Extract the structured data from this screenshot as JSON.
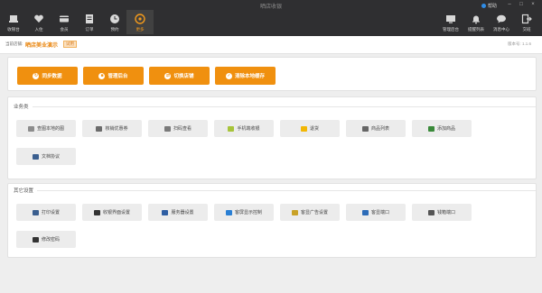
{
  "window": {
    "title": "晒店收银",
    "help": "帮助"
  },
  "nav": {
    "left": [
      {
        "label": "收银台",
        "icon": "cash-register-icon"
      },
      {
        "label": "入住",
        "icon": "heart-icon"
      },
      {
        "label": "会员",
        "icon": "member-card-icon"
      },
      {
        "label": "订单",
        "icon": "order-list-icon"
      },
      {
        "label": "预约",
        "icon": "clock-icon"
      },
      {
        "label": "更多",
        "icon": "more-grid-icon",
        "active": true
      }
    ],
    "right": [
      {
        "label": "管理后台",
        "icon": "monitor-icon"
      },
      {
        "label": "提醒列表",
        "icon": "bell-icon"
      },
      {
        "label": "消息中心",
        "icon": "chat-icon"
      },
      {
        "label": "交班",
        "icon": "logout-icon"
      }
    ]
  },
  "store": {
    "prefix": "当前店铺:",
    "name": "晒店美业演示",
    "badge": "试用",
    "version": "版本号: 1.1.6"
  },
  "actions": [
    {
      "label": "同步数据",
      "icon": "sync-icon"
    },
    {
      "label": "管理后台",
      "icon": "admin-icon"
    },
    {
      "label": "切换店铺",
      "icon": "switch-icon"
    },
    {
      "label": "清除本地缓存",
      "icon": "clear-icon"
    }
  ],
  "business": {
    "title": "业务类",
    "items": [
      {
        "label": "查图本地的图",
        "icon": "image-icon",
        "color": "#8c8c8c"
      },
      {
        "label": "核销优惠券",
        "icon": "coupon-icon",
        "color": "#6b6b6b"
      },
      {
        "label": "扫码查看",
        "icon": "scan-icon",
        "color": "#7a7a7a"
      },
      {
        "label": "手机端收银",
        "icon": "phone-icon",
        "color": "#a7c43a"
      },
      {
        "label": "退货",
        "icon": "return-icon",
        "color": "#f2b705"
      },
      {
        "label": "商品列表",
        "icon": "list-icon",
        "color": "#666666"
      },
      {
        "label": "添加商品",
        "icon": "add-icon",
        "color": "#3a8a3a"
      },
      {
        "label": "文档协议",
        "icon": "doc-icon",
        "color": "#3b5f8f"
      }
    ]
  },
  "other": {
    "title": "其它设置",
    "items": [
      {
        "label": "打印设置",
        "icon": "printer-icon",
        "color": "#3b5f8f"
      },
      {
        "label": "收银界面设置",
        "icon": "cash-ui-icon",
        "color": "#333333"
      },
      {
        "label": "服务器设置",
        "icon": "server-icon",
        "color": "#2f5fa3"
      },
      {
        "label": "客屏显示控制",
        "icon": "display-icon",
        "color": "#2a7fd4"
      },
      {
        "label": "客显广告设置",
        "icon": "ad-icon",
        "color": "#c9a227"
      },
      {
        "label": "客显端口",
        "icon": "port-icon",
        "color": "#2d6cb8"
      },
      {
        "label": "钱箱端口",
        "icon": "cashbox-icon",
        "color": "#555555"
      },
      {
        "label": "修改密码",
        "icon": "password-icon",
        "color": "#333333"
      }
    ]
  },
  "colors": {
    "accent": "#f0900f",
    "topbar": "#2f2f31"
  }
}
